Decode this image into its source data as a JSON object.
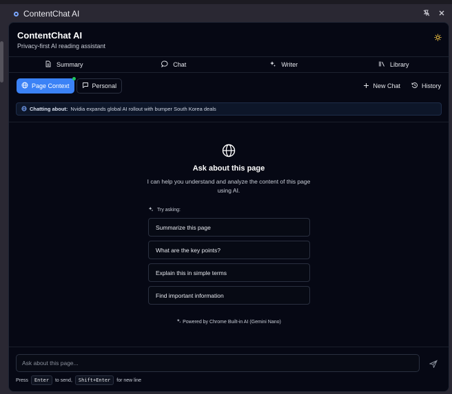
{
  "window": {
    "title": "ContentChat AI"
  },
  "header": {
    "title": "ContentChat AI",
    "subtitle": "Privacy-first AI reading assistant",
    "theme_icon": "sun-icon"
  },
  "tabs": [
    {
      "label": "Summary",
      "icon": "document-icon"
    },
    {
      "label": "Chat",
      "icon": "chat-bubble-icon"
    },
    {
      "label": "Writer",
      "icon": "sparkles-icon"
    },
    {
      "label": "Library",
      "icon": "library-icon"
    }
  ],
  "toolbar": {
    "page_context": "Page Context",
    "personal": "Personal",
    "new_chat": "New Chat",
    "history": "History"
  },
  "chatting": {
    "label": "Chatting about:",
    "title": "Nvidia expands global AI rollout with bumper South Korea deals"
  },
  "empty": {
    "title": "Ask about this page",
    "description": "I can help you understand and analyze the content of this page using AI.",
    "try_label": "Try asking:",
    "suggestions": [
      "Summarize this page",
      "What are the key points?",
      "Explain this in simple terms",
      "Find important information"
    ]
  },
  "powered": "Powered by Chrome Built-in AI (Gemini Nano)",
  "input": {
    "placeholder": "Ask about this page..."
  },
  "hint": {
    "press": "Press",
    "enter": "Enter",
    "to_send": "to send,",
    "shift_enter": "Shift+Enter",
    "new_line": "for new line"
  },
  "colors": {
    "accent": "#3b82f6",
    "background": "#060814",
    "status": "#22c55e",
    "theme": "#f5c542"
  }
}
